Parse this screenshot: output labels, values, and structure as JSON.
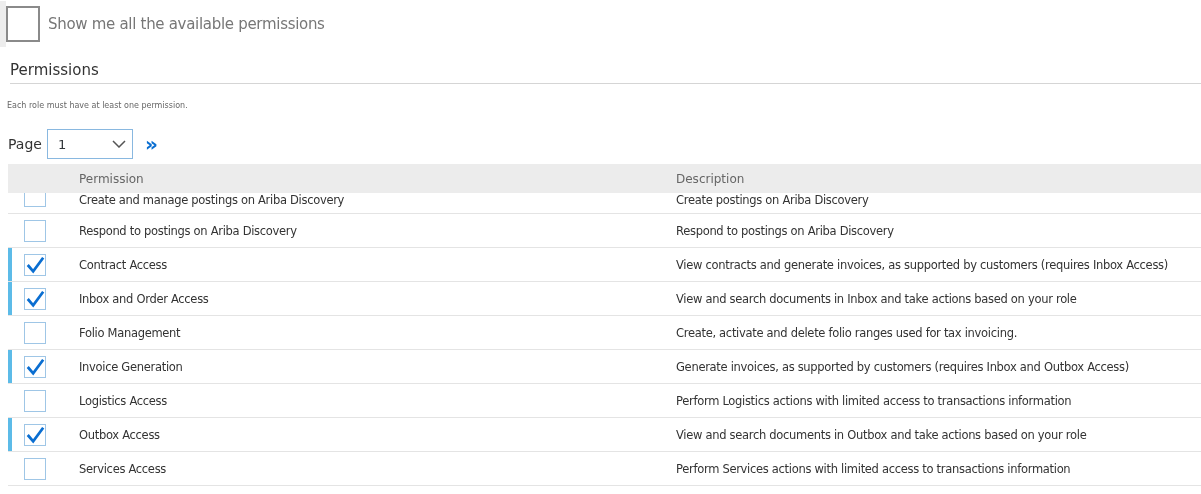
{
  "show_all": {
    "label": "Show me all the available permissions",
    "checked": false
  },
  "section_title": "Permissions",
  "note": "Each role must have at least one permission.",
  "pager": {
    "label": "Page",
    "value": "1",
    "next": "»"
  },
  "table": {
    "columns": [
      "Permission",
      "Description"
    ],
    "rows": [
      {
        "permission": "Create and manage postings on Ariba Discovery",
        "description": "Create postings on Ariba Discovery",
        "checked": false
      },
      {
        "permission": "Respond to postings on Ariba Discovery",
        "description": "Respond to postings on Ariba Discovery",
        "checked": false
      },
      {
        "permission": "Contract Access",
        "description": "View contracts and generate invoices, as supported by customers (requires Inbox Access)",
        "checked": true
      },
      {
        "permission": "Inbox and Order Access",
        "description": "View and search documents in Inbox and take actions based on your role",
        "checked": true
      },
      {
        "permission": "Folio Management",
        "description": "Create, activate and delete folio ranges used for tax invoicing.",
        "checked": false
      },
      {
        "permission": "Invoice Generation",
        "description": "Generate invoices, as supported by customers (requires Inbox and Outbox Access)",
        "checked": true
      },
      {
        "permission": "Logistics Access",
        "description": "Perform Logistics actions with limited access to transactions information",
        "checked": false
      },
      {
        "permission": "Outbox Access",
        "description": "View and search documents in Outbox and take actions based on your role",
        "checked": true
      },
      {
        "permission": "Services Access",
        "description": "Perform Services actions with limited access to transactions information",
        "checked": false
      }
    ]
  }
}
